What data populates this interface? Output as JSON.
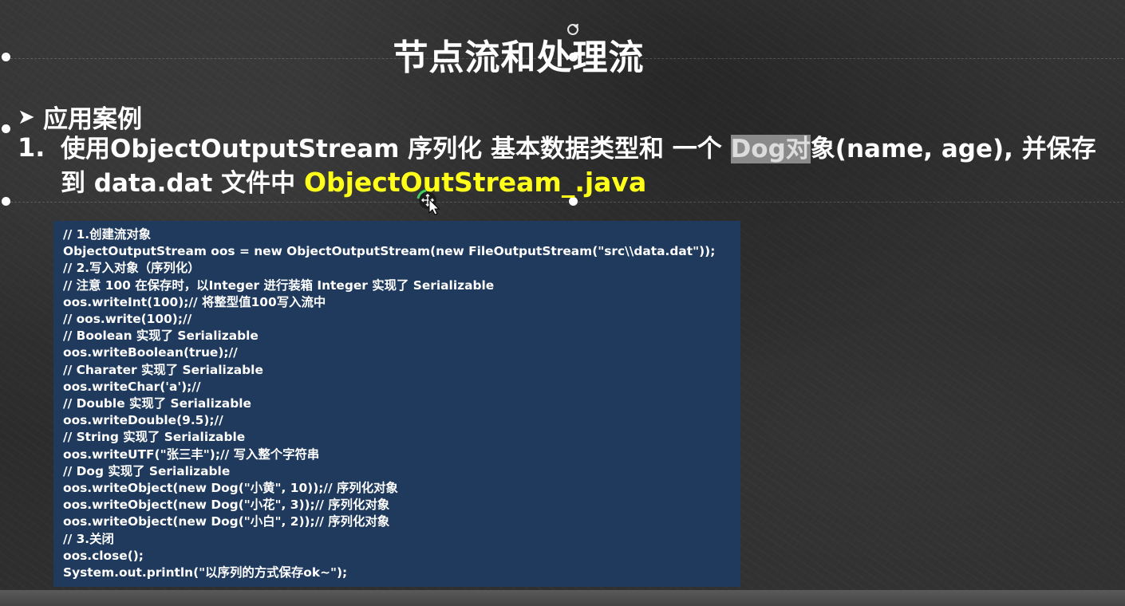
{
  "slide": {
    "title": "节点流和处理流",
    "section_label": "应用案例",
    "item": {
      "number": "1.",
      "text_part1": "使用ObjectOutputStream 序列化 基本数据类型和 一个 ",
      "highlight_dog": "Dog对",
      "text_part2": "象(name, age), 并保存到 data.dat 文件中 ",
      "highlight_file": "ObjectOutStream_.java"
    },
    "code_lines": [
      "// 1.创建流对象",
      "ObjectOutputStream oos = new ObjectOutputStream(new FileOutputStream(\"src\\\\data.dat\"));",
      "// 2.写入对象（序列化）",
      "// 注意 100 在保存时，以Integer 进行装箱 Integer 实现了 Serializable",
      "oos.writeInt(100);// 将整型值100写入流中",
      "// oos.write(100);//",
      "// Boolean 实现了 Serializable",
      "oos.writeBoolean(true);//",
      "// Charater 实现了 Serializable",
      "oos.writeChar('a');//",
      "// Double 实现了 Serializable",
      "oos.writeDouble(9.5);//",
      "// String 实现了 Serializable",
      "oos.writeUTF(\"张三丰\");// 写入整个字符串",
      "// Dog 实现了 Serializable",
      "oos.writeObject(new Dog(\"小黄\", 10));// 序列化对象",
      "oos.writeObject(new Dog(\"小花\", 3));// 序列化对象",
      "oos.writeObject(new Dog(\"小白\", 2));// 序列化对象",
      "// 3.关闭",
      "oos.close();",
      "System.out.println(\"以序列的方式保存ok~\");"
    ]
  },
  "colors": {
    "code_background": "#1f3a5c",
    "file_highlight": "#ffff1a",
    "dog_highlight_bg": "#8a8a8a"
  },
  "icons": {
    "bullet": "arrow-bullet-icon",
    "cursor": "move-cursor-icon",
    "rotate": "rotate-handle-icon"
  }
}
